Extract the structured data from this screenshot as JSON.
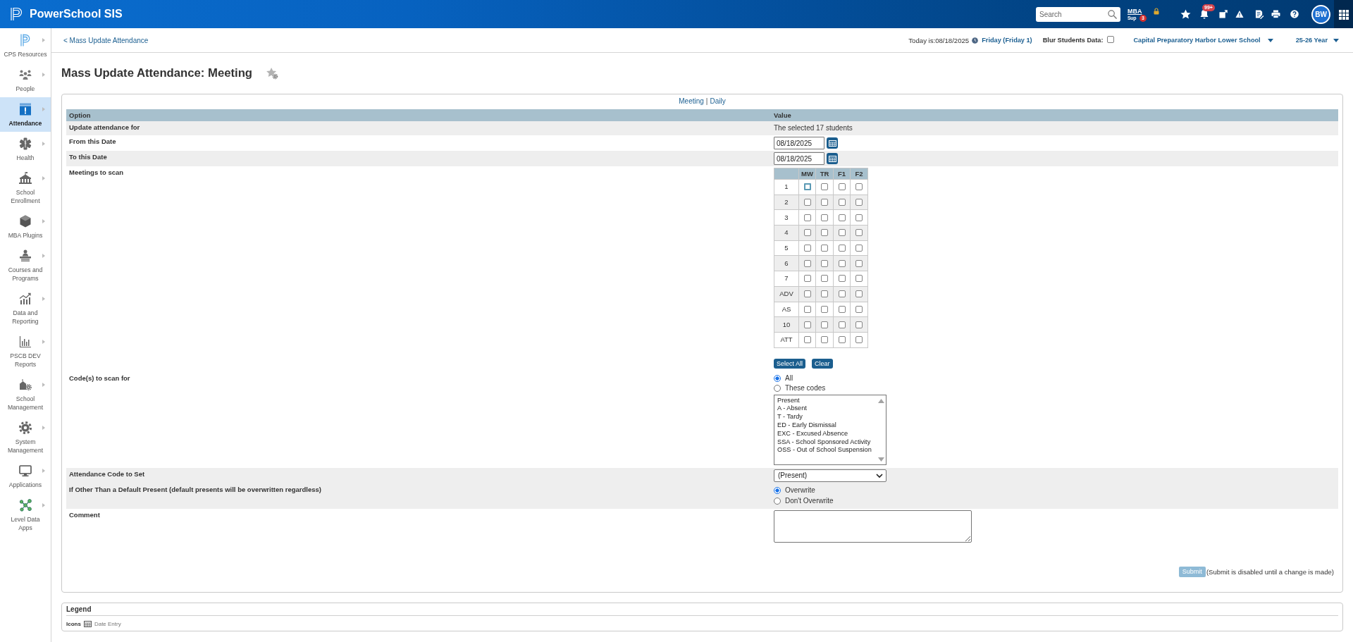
{
  "top_bar": {
    "app_title": "PowerSchool SIS",
    "search": {
      "placeholder": "Search"
    },
    "mba_support": {
      "line_1": "MBA",
      "line_2": "Sup",
      "badge": "3"
    },
    "notifications": {
      "badge": "99+"
    },
    "avatar": "BW"
  },
  "sidebar": {
    "items": [
      {
        "label": "CPS Resources",
        "selected": false
      },
      {
        "label": "People",
        "selected": false
      },
      {
        "label": "Attendance",
        "selected": true
      },
      {
        "label": "Health",
        "selected": false
      },
      {
        "label": "School\nEnrollment",
        "selected": false
      },
      {
        "label": "MBA Plugins",
        "selected": false
      },
      {
        "label": "Courses and\nPrograms",
        "selected": false
      },
      {
        "label": "Data and\nReporting",
        "selected": false
      },
      {
        "label": "PSCB DEV\nReports",
        "selected": false
      },
      {
        "label": "School\nManagement",
        "selected": false
      },
      {
        "label": "System\nManagement",
        "selected": false
      },
      {
        "label": "Applications",
        "selected": false
      },
      {
        "label": "Level Data\nApps",
        "selected": false
      }
    ]
  },
  "header": {
    "back_link": "< Mass Update Attendance",
    "today": "Today is:08/18/2025",
    "day_link": "Friday (Friday 1)",
    "blur_label": "Blur Students Data:",
    "blur_checked": false,
    "school": "Capital Preparatory Harbor Lower School",
    "year": "25-26 Year"
  },
  "page": {
    "title": "Mass Update Attendance: Meeting",
    "mode_links": [
      "Meeting",
      "Daily"
    ],
    "mode_separator": "|"
  },
  "form": {
    "columns": [
      "Option",
      "Value"
    ],
    "rows": [
      {
        "kind": "text",
        "label": "Update attendance for",
        "shaded": true,
        "value": "The selected 17 students"
      },
      {
        "kind": "date",
        "label": "From this Date",
        "shaded": false,
        "value": "08/18/2025"
      },
      {
        "kind": "date",
        "label": "To this Date",
        "shaded": true,
        "value": "08/18/2025"
      },
      {
        "kind": "meetings",
        "label": "Meetings to scan",
        "shaded": false,
        "grid": {
          "columns": [
            "MW",
            "TR",
            "F1",
            "F2"
          ],
          "rows": [
            {
              "period": "1",
              "cells": [
                {
                  "checked": false,
                  "focused": true
                },
                {
                  "checked": false,
                  "focused": false
                },
                {
                  "checked": false,
                  "focused": false
                },
                {
                  "checked": false,
                  "focused": false
                }
              ]
            },
            {
              "period": "2",
              "cells": [
                {
                  "checked": false,
                  "focused": false
                },
                {
                  "checked": false,
                  "focused": false
                },
                {
                  "checked": false,
                  "focused": false
                },
                {
                  "checked": false,
                  "focused": false
                }
              ]
            },
            {
              "period": "3",
              "cells": [
                {
                  "checked": false,
                  "focused": false
                },
                {
                  "checked": false,
                  "focused": false
                },
                {
                  "checked": false,
                  "focused": false
                },
                {
                  "checked": false,
                  "focused": false
                }
              ]
            },
            {
              "period": "4",
              "cells": [
                {
                  "checked": false,
                  "focused": false
                },
                {
                  "checked": false,
                  "focused": false
                },
                {
                  "checked": false,
                  "focused": false
                },
                {
                  "checked": false,
                  "focused": false
                }
              ]
            },
            {
              "period": "5",
              "cells": [
                {
                  "checked": false,
                  "focused": false
                },
                {
                  "checked": false,
                  "focused": false
                },
                {
                  "checked": false,
                  "focused": false
                },
                {
                  "checked": false,
                  "focused": false
                }
              ]
            },
            {
              "period": "6",
              "cells": [
                {
                  "checked": false,
                  "focused": false
                },
                {
                  "checked": false,
                  "focused": false
                },
                {
                  "checked": false,
                  "focused": false
                },
                {
                  "checked": false,
                  "focused": false
                }
              ]
            },
            {
              "period": "7",
              "cells": [
                {
                  "checked": false,
                  "focused": false
                },
                {
                  "checked": false,
                  "focused": false
                },
                {
                  "checked": false,
                  "focused": false
                },
                {
                  "checked": false,
                  "focused": false
                }
              ]
            },
            {
              "period": "ADV",
              "cells": [
                {
                  "checked": false,
                  "focused": false
                },
                {
                  "checked": false,
                  "focused": false
                },
                {
                  "checked": false,
                  "focused": false
                },
                {
                  "checked": false,
                  "focused": false
                }
              ]
            },
            {
              "period": "AS",
              "cells": [
                {
                  "checked": false,
                  "focused": false
                },
                {
                  "checked": false,
                  "focused": false
                },
                {
                  "checked": false,
                  "focused": false
                },
                {
                  "checked": false,
                  "focused": false
                }
              ]
            },
            {
              "period": "10",
              "cells": [
                {
                  "checked": false,
                  "focused": false
                },
                {
                  "checked": false,
                  "focused": false
                },
                {
                  "checked": false,
                  "focused": false
                },
                {
                  "checked": false,
                  "focused": false
                }
              ]
            },
            {
              "period": "ATT",
              "cells": [
                {
                  "checked": false,
                  "focused": false
                },
                {
                  "checked": false,
                  "focused": false
                },
                {
                  "checked": false,
                  "focused": false
                },
                {
                  "checked": false,
                  "focused": false
                }
              ]
            }
          ]
        },
        "buttons": [
          "Select All",
          "Clear"
        ]
      },
      {
        "kind": "codes",
        "label": "Code(s) to scan for",
        "shaded": false,
        "options": [
          {
            "label": "All",
            "selected": true
          },
          {
            "label": "These codes",
            "selected": false
          }
        ],
        "codes": [
          {
            "label": "Present",
            "selected": false
          },
          {
            "label": "A - Absent",
            "selected": false
          },
          {
            "label": "T - Tardy",
            "selected": false
          },
          {
            "label": "ED - Early Dismissal",
            "selected": false
          },
          {
            "label": "EXC - Excused Absence",
            "selected": false
          },
          {
            "label": "SSA - School Sponsored Activity",
            "selected": false
          },
          {
            "label": "OSS - Out of School Suspension",
            "selected": false
          }
        ]
      },
      {
        "kind": "select",
        "label": "Attendance Code to Set",
        "shaded": true,
        "value": "(Present)"
      },
      {
        "kind": "radios",
        "label": "If Other Than a Default Present (default presents will be overwritten regardless)",
        "shaded": true,
        "options": [
          {
            "label": "Overwrite",
            "selected": true
          },
          {
            "label": "Don't Overwrite",
            "selected": false
          }
        ]
      },
      {
        "kind": "textarea",
        "label": "Comment",
        "shaded": false
      }
    ]
  },
  "submit": {
    "label": "Submit",
    "disabled": true,
    "note": "(Submit is disabled until a change is made)"
  },
  "legend": {
    "title": "Legend",
    "icons_label": "Icons",
    "items": [
      "Date Entry"
    ]
  }
}
